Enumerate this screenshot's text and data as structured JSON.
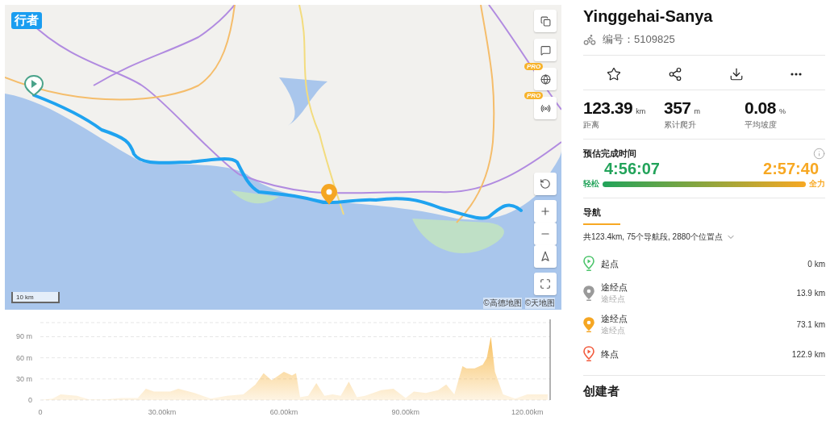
{
  "map": {
    "logo": "行者",
    "top_controls": [
      {
        "kind": "layers"
      },
      {
        "kind": "comment"
      },
      {
        "kind": "globe",
        "badge": "PRO"
      },
      {
        "kind": "signal",
        "badge": "PRO"
      }
    ],
    "bottom_controls": [
      {
        "kind": "reset"
      },
      {
        "kind": "zoom-in"
      },
      {
        "kind": "zoom-out"
      },
      {
        "kind": "compass"
      },
      {
        "kind": "fullscreen"
      }
    ],
    "scale": "10 km",
    "attribution": [
      "©高德地图",
      "©天地图"
    ]
  },
  "elevation": {
    "chart_data": {
      "type": "area",
      "x": [
        0,
        3,
        5,
        9,
        12,
        16,
        20,
        24,
        26,
        28,
        32,
        34,
        38,
        42,
        46,
        50,
        53,
        55,
        57,
        60,
        62,
        63,
        64,
        66,
        68,
        70,
        72,
        74,
        76,
        78,
        80,
        84,
        87,
        90,
        92,
        95,
        98,
        100,
        102,
        104,
        105,
        107,
        109,
        110,
        111,
        112,
        114,
        117,
        120,
        125
      ],
      "grid": true,
      "series": [
        {
          "color": "#f7b84a",
          "values": [
            0,
            2,
            8,
            6,
            1,
            1,
            3,
            3,
            16,
            12,
            12,
            16,
            10,
            2,
            6,
            8,
            22,
            38,
            28,
            40,
            35,
            38,
            4,
            6,
            24,
            6,
            8,
            6,
            26,
            4,
            6,
            14,
            16,
            3,
            12,
            10,
            14,
            22,
            8,
            48,
            45,
            45,
            50,
            60,
            90,
            40,
            8,
            2,
            8,
            8
          ]
        }
      ],
      "xlim": [
        0,
        125.6
      ],
      "ylim": [
        0,
        110
      ],
      "xticks": [
        {
          "value": 0,
          "label": "0"
        },
        {
          "value": 30,
          "label": "30.00km"
        },
        {
          "value": 60,
          "label": "60.00km"
        },
        {
          "value": 90,
          "label": "90.00km"
        },
        {
          "value": 120,
          "label": "120.00km"
        }
      ],
      "yticks": [
        {
          "value": 0,
          "label": "0"
        },
        {
          "value": 30,
          "label": "30 m"
        },
        {
          "value": 60,
          "label": "60 m"
        },
        {
          "value": 90,
          "label": "90 m"
        }
      ]
    }
  },
  "route": {
    "title": "Yinggehai-Sanya",
    "id_label": "编号：5109825",
    "actions": [
      {
        "kind": "star"
      },
      {
        "kind": "share"
      },
      {
        "kind": "download"
      },
      {
        "kind": "more"
      }
    ],
    "stats": [
      {
        "value": "123.39",
        "unit": "km",
        "label": "距离"
      },
      {
        "value": "357",
        "unit": "m",
        "label": "累计爬升"
      },
      {
        "value": "0.08",
        "unit": "%",
        "label": "平均坡度"
      }
    ],
    "estimate": {
      "title": "预估完成时间",
      "easy_time": "4:56:07",
      "max_time": "2:57:40",
      "easy_label": "轻松",
      "max_label": "全力"
    },
    "navigation": {
      "tab": "导航",
      "summary": "共123.4km, 75个导航段, 2880个位置点",
      "points": [
        {
          "kind": "start",
          "name": "起点",
          "distance": "0 km",
          "color": "#4cc46b"
        },
        {
          "kind": "waypoint",
          "name": "途经点",
          "sub": "途经点",
          "distance": "13.9 km",
          "color": "#9a9a9a"
        },
        {
          "kind": "waypoint",
          "name": "途经点",
          "sub": "途经点",
          "distance": "73.1 km",
          "color": "#f5a623"
        },
        {
          "kind": "end",
          "name": "终点",
          "distance": "122.9 km",
          "color": "#f25a3c"
        }
      ]
    },
    "creator_title": "创建者"
  }
}
